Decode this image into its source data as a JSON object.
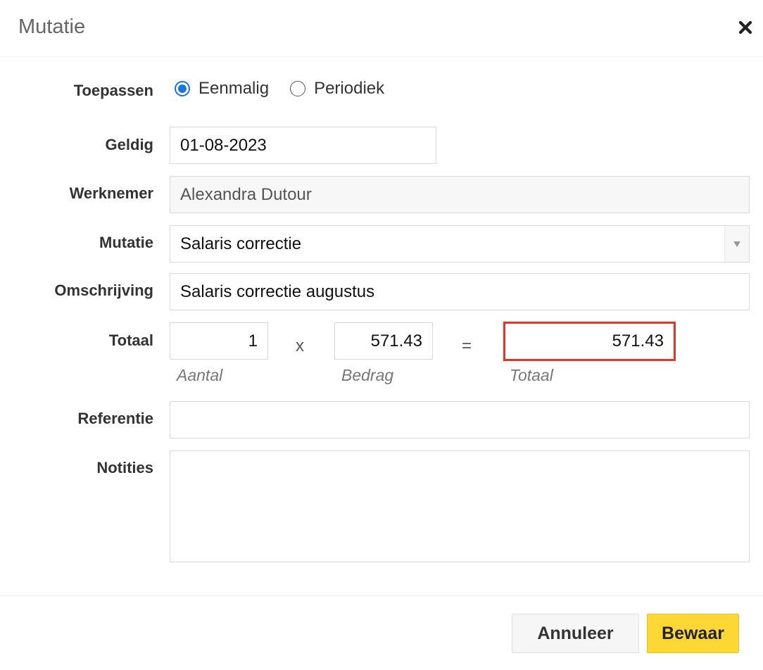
{
  "dialog": {
    "title": "Mutatie"
  },
  "form": {
    "toepassen": {
      "label": "Toepassen",
      "options": [
        {
          "label": "Eenmalig",
          "checked": true
        },
        {
          "label": "Periodiek",
          "checked": false
        }
      ]
    },
    "geldig": {
      "label": "Geldig",
      "value": "01-08-2023"
    },
    "werknemer": {
      "label": "Werknemer",
      "value": "Alexandra Dutour"
    },
    "mutatie": {
      "label": "Mutatie",
      "value": "Salaris correctie"
    },
    "omschrijving": {
      "label": "Omschrijving",
      "value": "Salaris correctie augustus"
    },
    "totaal": {
      "label": "Totaal",
      "aantal_value": "1",
      "aantal_hint": "Aantal",
      "multiply_sign": "x",
      "bedrag_value": "571.43",
      "bedrag_hint": "Bedrag",
      "equals_sign": "=",
      "totaal_value": "571.43",
      "totaal_hint": "Totaal",
      "highlight_color": "#ea3323"
    },
    "referentie": {
      "label": "Referentie",
      "value": ""
    },
    "notities": {
      "label": "Notities",
      "value": ""
    }
  },
  "footer": {
    "cancel_label": "Annuleer",
    "save_label": "Bewaar"
  },
  "colors": {
    "accent_radio": "#1a73e8",
    "save_button": "#fdd835"
  }
}
